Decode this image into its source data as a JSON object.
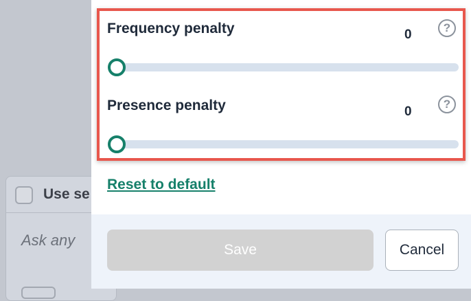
{
  "background": {
    "header_label": "Use se",
    "placeholder_text": "Ask any"
  },
  "modal": {
    "params": [
      {
        "title": "Frequency penalty",
        "value": "0",
        "slider_fraction": 0
      },
      {
        "title": "Presence penalty",
        "value": "0",
        "slider_fraction": 0
      }
    ],
    "help_glyph": "?",
    "reset_label": "Reset to default",
    "save_label": "Save",
    "cancel_label": "Cancel"
  },
  "colors": {
    "accent": "#16806a",
    "highlight": "#e8574d",
    "track": "#d7e1ed"
  },
  "icons": [
    "question-circle-icon",
    "checkbox-icon"
  ]
}
